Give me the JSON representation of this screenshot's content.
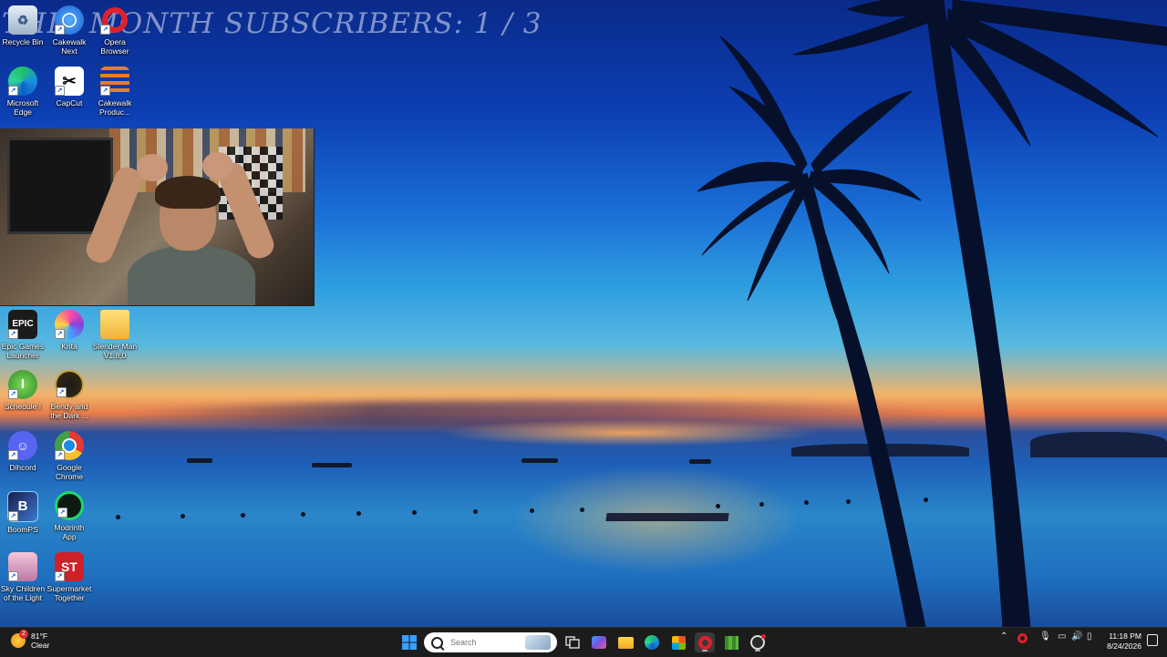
{
  "overlay": {
    "subscribers_text": "THIS MONTH SUBSCRIBERS: 1 / 3"
  },
  "desktop": {
    "icons": [
      {
        "label": "Recycle Bin",
        "icon": "recycle-bin-icon"
      },
      {
        "label": "Cakewalk Next",
        "icon": "cakewalk-next-icon"
      },
      {
        "label": "Opera Browser",
        "icon": "opera-icon"
      },
      {
        "label": "Microsoft Edge",
        "icon": "edge-icon"
      },
      {
        "label": "CapCut",
        "icon": "capcut-icon"
      },
      {
        "label": "Cakewalk Produc...",
        "icon": "cakewalk-producer-icon"
      },
      {
        "label": "Epic Games Launcher",
        "icon": "epic-games-icon"
      },
      {
        "label": "Krita",
        "icon": "krita-icon"
      },
      {
        "label": "Slender Man V1.8.0",
        "icon": "folder-icon"
      },
      {
        "label": "Schedule I",
        "icon": "schedule-i-icon"
      },
      {
        "label": "Bendy and the Dark ...",
        "icon": "bendy-icon"
      },
      {
        "label": "Dihcord",
        "icon": "discord-icon"
      },
      {
        "label": "Google Chrome",
        "icon": "chrome-icon"
      },
      {
        "label": "BoomPS",
        "icon": "boomps-icon"
      },
      {
        "label": "Modrinth App",
        "icon": "modrinth-icon"
      },
      {
        "label": "Sky Children of the Light",
        "icon": "sky-icon"
      },
      {
        "label": "Supermarket Together",
        "icon": "supermarket-together-icon"
      }
    ]
  },
  "taskbar": {
    "weather": {
      "temp": "81°F",
      "condition": "Clear",
      "badge": "2"
    },
    "search_placeholder": "Search",
    "clock": {
      "time": "11:18 PM",
      "date": "8/24/2026"
    },
    "apps": [
      "windows-start-icon",
      "task-view-icon",
      "widgets-icon",
      "file-explorer-icon",
      "edge-icon",
      "store-icon",
      "opera-icon",
      "minecraft-icon",
      "obs-icon"
    ],
    "tray": [
      "chevron-up-icon",
      "opera-gx-tray-icon",
      "microphone-icon",
      "network-icon",
      "volume-icon",
      "battery-icon",
      "notification-icon"
    ]
  },
  "colors": {
    "taskbar_bg": "#1c1c1c",
    "overlay_text": "#96a5d2"
  }
}
